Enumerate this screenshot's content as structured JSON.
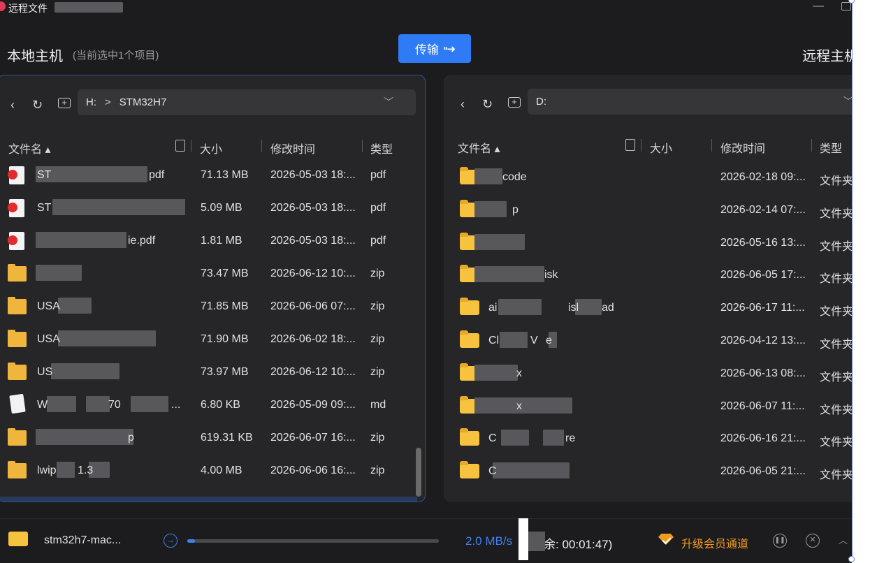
{
  "window": {
    "title": "远程文件",
    "minimize": "—"
  },
  "local": {
    "heading": "本地主机",
    "selection_info": "(当前选中1个项目)",
    "path": {
      "drive": "H:",
      "sep": ">",
      "folder": "STM32H7"
    },
    "columns": {
      "name": "文件名 ▴",
      "size": "大小",
      "modified": "修改时间",
      "type": "类型"
    },
    "files": [
      {
        "icon": "pdf-file-icon",
        "name": "ST",
        "name_tail": "pdf",
        "size": "71.13 MB",
        "modified": "2026-05-03 18:...",
        "type": "pdf"
      },
      {
        "icon": "pdf-file-icon",
        "name": "ST",
        "name_tail": "",
        "size": "5.09 MB",
        "modified": "2026-05-03 18:...",
        "type": "pdf"
      },
      {
        "icon": "pdf-file-icon",
        "name": "",
        "name_tail": "ie.pdf",
        "size": "1.81 MB",
        "modified": "2026-05-03 18:...",
        "type": "pdf"
      },
      {
        "icon": "zip-file-icon",
        "name": "",
        "name_tail": "",
        "size": "73.47 MB",
        "modified": "2026-06-12 10:...",
        "type": "zip"
      },
      {
        "icon": "zip-file-icon",
        "name": "USA",
        "name_tail": "",
        "size": "71.85 MB",
        "modified": "2026-06-06 07:...",
        "type": "zip"
      },
      {
        "icon": "zip-file-icon",
        "name": "USA",
        "name_tail": "",
        "size": "71.90 MB",
        "modified": "2026-06-02 18:...",
        "type": "zip"
      },
      {
        "icon": "zip-file-icon",
        "name": "US",
        "name_tail": "",
        "size": "73.97 MB",
        "modified": "2026-06-12 10:...",
        "type": "zip"
      },
      {
        "icon": "markdown-file-icon",
        "name": "W",
        "name_tail": "70",
        "name_end": "...",
        "size": "6.80 KB",
        "modified": "2026-05-09 09:...",
        "type": "md"
      },
      {
        "icon": "zip-file-icon",
        "name": "",
        "name_tail": "p",
        "size": "619.31 KB",
        "modified": "2026-06-07 16:...",
        "type": "zip"
      },
      {
        "icon": "zip-file-icon",
        "name": "lwip",
        "name_tail": "1.3",
        "size": "4.00 MB",
        "modified": "2026-06-06 16:...",
        "type": "zip"
      }
    ]
  },
  "remote": {
    "heading": "远程主机",
    "path": {
      "drive": "D:"
    },
    "columns": {
      "name": "文件名 ▴",
      "size": "大小",
      "modified": "修改时间",
      "type": "类型"
    },
    "files": [
      {
        "name": "code",
        "modified": "2026-02-18 09:...",
        "type": "文件夹"
      },
      {
        "name": "p",
        "modified": "2026-02-14 07:...",
        "type": "文件夹"
      },
      {
        "name": "",
        "modified": "2026-05-16 13:...",
        "type": "文件夹"
      },
      {
        "name": "isk",
        "modified": "2026-06-05 17:...",
        "type": "文件夹"
      },
      {
        "name": "ai",
        "name_mid": "isl",
        "name_tail": "ad",
        "modified": "2026-06-17 11:...",
        "type": "文件夹"
      },
      {
        "name": "Cl",
        "name_mid": "V",
        "name_tail": "e",
        "modified": "2026-04-12 13:...",
        "type": "文件夹"
      },
      {
        "name": "x",
        "modified": "2026-06-13 08:...",
        "type": "文件夹"
      },
      {
        "name": "x",
        "modified": "2026-06-07 11:...",
        "type": "文件夹"
      },
      {
        "name": "C",
        "name_mid": "",
        "name_tail": "re",
        "modified": "2026-06-16 21:...",
        "type": "文件夹"
      },
      {
        "name": "C",
        "modified": "2026-06-05 21:...",
        "type": "文件夹"
      }
    ]
  },
  "toolbar": {
    "transfer_label": "传输",
    "transfer_arrow": "⁍➜"
  },
  "status": {
    "file_name": "stm32h7-mac...",
    "progress": 0.03,
    "speed": "2.0 MB/s",
    "remaining": "余: 00:01:47)",
    "upgrade_label": "升级会员通道"
  },
  "colors": {
    "accent": "#2f7bf5",
    "vip": "#f29a1e",
    "folder": "#f7c23e"
  }
}
